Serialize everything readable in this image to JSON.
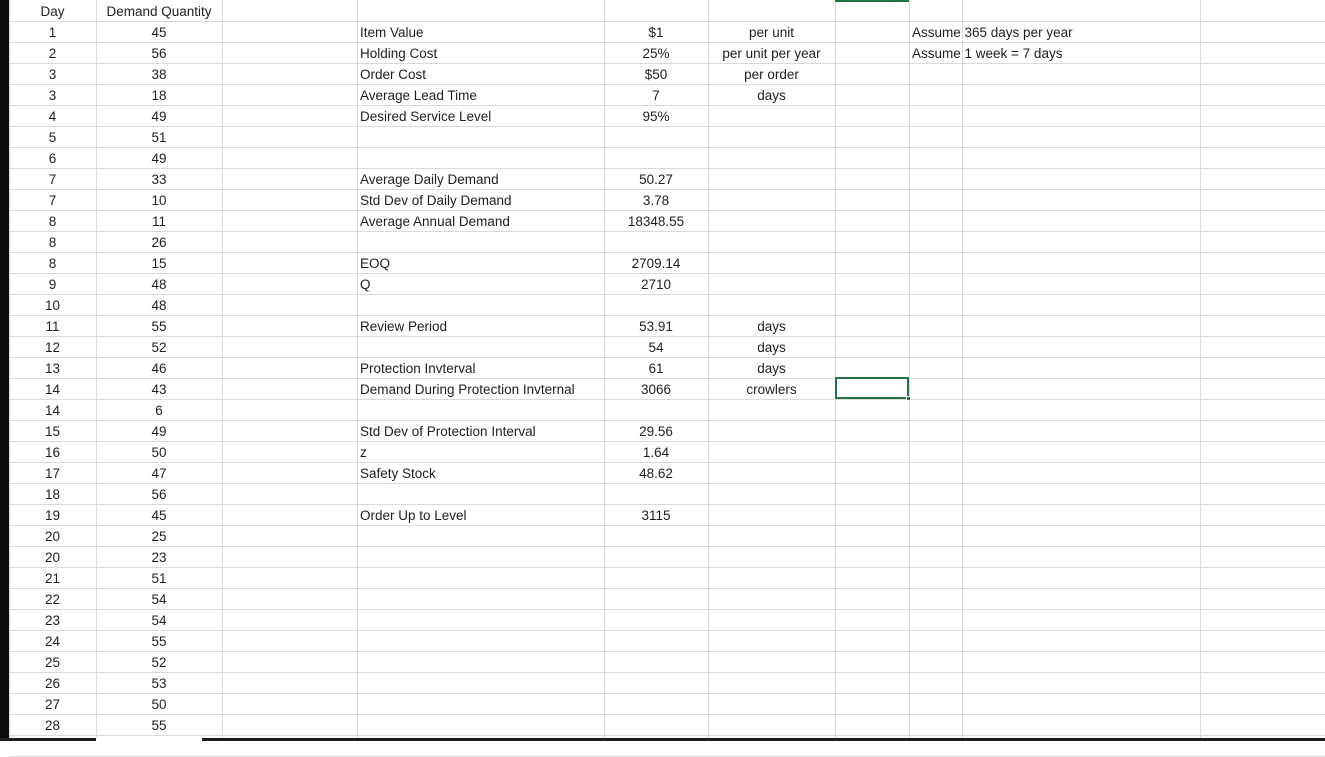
{
  "column_a": {
    "header": "Day",
    "values": [
      "1",
      "2",
      "3",
      "3",
      "4",
      "5",
      "6",
      "7",
      "7",
      "8",
      "8",
      "8",
      "9",
      "10",
      "11",
      "12",
      "13",
      "14",
      "14",
      "15",
      "16",
      "17",
      "18",
      "19",
      "20",
      "20",
      "21",
      "22",
      "23",
      "24",
      "25",
      "26",
      "27",
      "28"
    ]
  },
  "column_b": {
    "header": "Demand Quantity",
    "values": [
      "45",
      "56",
      "38",
      "18",
      "49",
      "51",
      "49",
      "33",
      "10",
      "11",
      "26",
      "15",
      "48",
      "48",
      "55",
      "52",
      "46",
      "43",
      "6",
      "49",
      "50",
      "47",
      "56",
      "45",
      "25",
      "23",
      "51",
      "54",
      "54",
      "55",
      "52",
      "53",
      "50",
      "55"
    ]
  },
  "params": [
    {
      "row": 1,
      "label": "Item Value",
      "value": "$1",
      "unit": "per unit",
      "note": "Assume 365 days per year"
    },
    {
      "row": 2,
      "label": "Holding Cost",
      "value": "25%",
      "unit": "per unit per year",
      "note": "Assume 1 week = 7 days"
    },
    {
      "row": 3,
      "label": "Order Cost",
      "value": "$50",
      "unit": "per order",
      "note": ""
    },
    {
      "row": 4,
      "label": "Average Lead Time",
      "value": "7",
      "unit": "days",
      "note": ""
    },
    {
      "row": 5,
      "label": "Desired Service Level",
      "value": "95%",
      "unit": "",
      "note": ""
    },
    {
      "row": 8,
      "label": "Average Daily Demand",
      "value": "50.27",
      "unit": "",
      "note": ""
    },
    {
      "row": 9,
      "label": "Std Dev of Daily Demand",
      "value": "3.78",
      "unit": "",
      "note": ""
    },
    {
      "row": 10,
      "label": "Average Annual Demand",
      "value": "18348.55",
      "unit": "",
      "note": ""
    },
    {
      "row": 12,
      "label": "EOQ",
      "value": "2709.14",
      "unit": "",
      "note": ""
    },
    {
      "row": 13,
      "label": "Q",
      "value": "2710",
      "unit": "",
      "note": ""
    },
    {
      "row": 15,
      "label": "Review Period",
      "value": "53.91",
      "unit": "days",
      "note": ""
    },
    {
      "row": 16,
      "label": "",
      "value": "54",
      "unit": "days",
      "note": ""
    },
    {
      "row": 17,
      "label": "Protection Invterval",
      "value": "61",
      "unit": "days",
      "note": ""
    },
    {
      "row": 18,
      "label": "Demand During Protection Invternal",
      "value": "3066",
      "unit": "crowlers",
      "note": ""
    },
    {
      "row": 20,
      "label": "Std Dev of Protection Interval",
      "value": "29.56",
      "unit": "",
      "note": ""
    },
    {
      "row": 21,
      "label": "z",
      "value": "1.64",
      "unit": "",
      "note": ""
    },
    {
      "row": 22,
      "label": "Safety Stock",
      "value": "48.62",
      "unit": "",
      "note": ""
    },
    {
      "row": 24,
      "label": "Order Up to Level",
      "value": "3115",
      "unit": "",
      "note": ""
    }
  ],
  "colors": {
    "gridline": "#d9d9d9",
    "selection": "#217346",
    "text": "#1f1f1f"
  }
}
